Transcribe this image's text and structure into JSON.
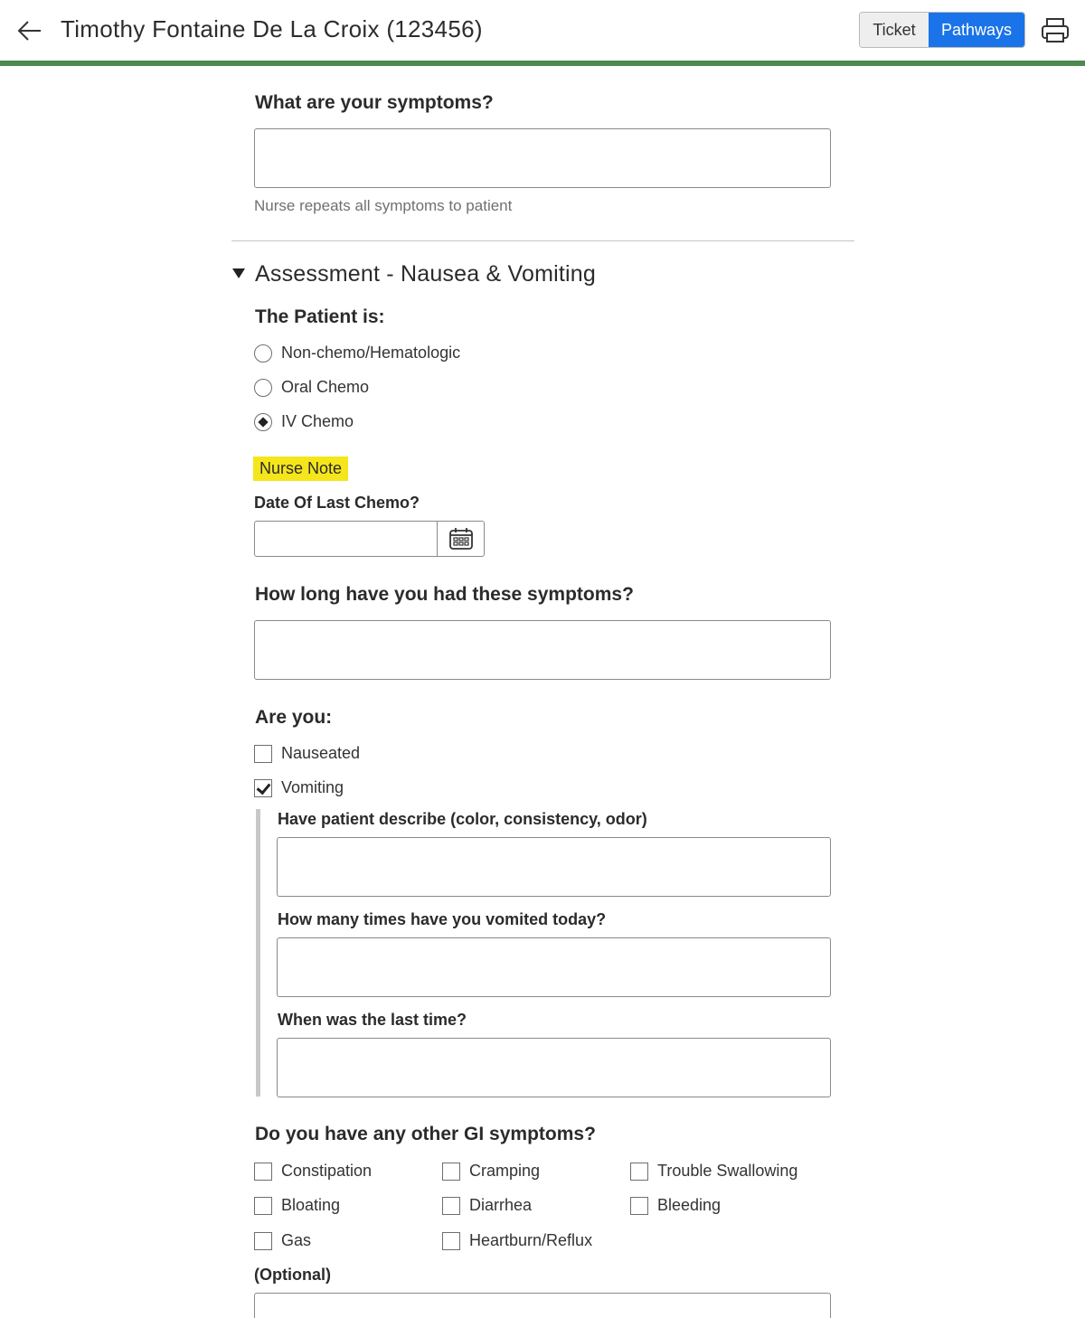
{
  "header": {
    "title": "Timothy Fontaine De La Croix (123456)",
    "tabs": [
      {
        "label": "Ticket",
        "active": false
      },
      {
        "label": "Pathways",
        "active": true
      }
    ],
    "accent_color": "#1a73e8",
    "bar_color": "#4c8a4f"
  },
  "symptoms": {
    "question": "What are your symptoms?",
    "value": "",
    "hint": "Nurse repeats all symptoms to patient"
  },
  "assessment": {
    "title": "Assessment - Nausea & Vomiting",
    "patient_question": "The Patient is:",
    "patient_options": [
      {
        "label": "Non-chemo/Hematologic",
        "selected": false
      },
      {
        "label": "Oral Chemo",
        "selected": false
      },
      {
        "label": "IV Chemo",
        "selected": true
      }
    ],
    "nurse_note": "Nurse Note",
    "last_chemo_label": "Date Of Last Chemo?",
    "last_chemo_value": "",
    "duration_question": "How long have you had these symptoms?",
    "duration_value": "",
    "are_you_question": "Are you:",
    "are_you_options": [
      {
        "label": "Nauseated",
        "checked": false
      },
      {
        "label": "Vomiting",
        "checked": true
      }
    ],
    "vomiting_followups": [
      {
        "label": "Have patient describe (color, consistency, odor)",
        "value": ""
      },
      {
        "label": "How many times have you vomited today?",
        "value": ""
      },
      {
        "label": "When was the last time?",
        "value": ""
      }
    ],
    "gi_question": "Do you have any other GI symptoms?",
    "gi_options": [
      {
        "label": "Constipation",
        "checked": false
      },
      {
        "label": "Cramping",
        "checked": false
      },
      {
        "label": "Trouble Swallowing",
        "checked": false
      },
      {
        "label": "Bloating",
        "checked": false
      },
      {
        "label": "Diarrhea",
        "checked": false
      },
      {
        "label": "Bleeding",
        "checked": false
      },
      {
        "label": "Gas",
        "checked": false
      },
      {
        "label": "Heartburn/Reflux",
        "checked": false
      }
    ],
    "optional_label": "(Optional)"
  }
}
